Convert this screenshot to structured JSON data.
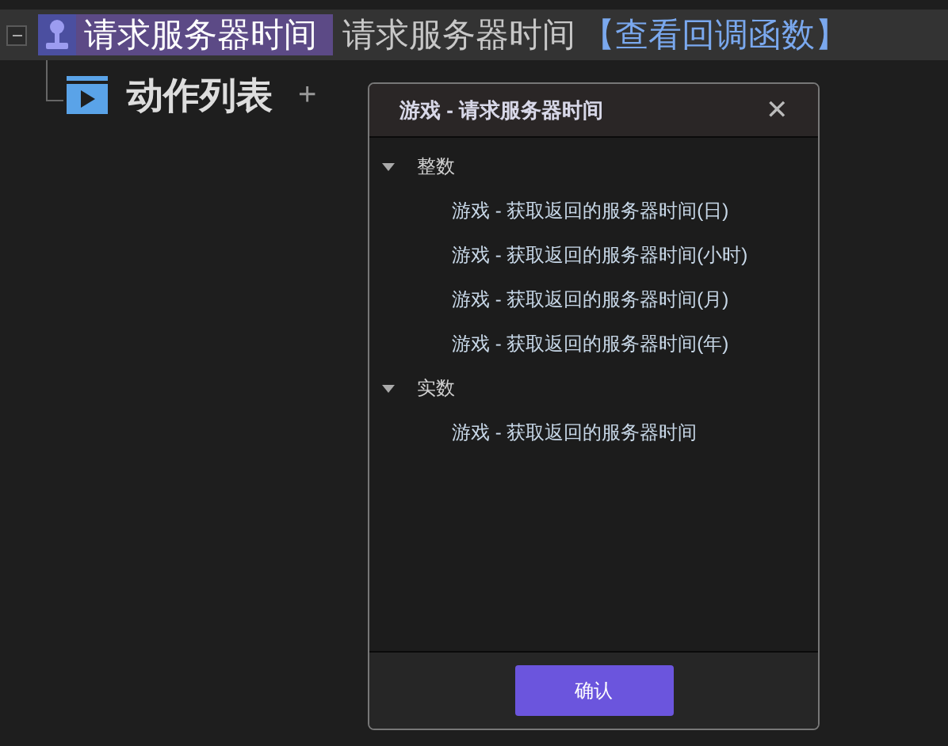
{
  "event_row": {
    "title": "请求服务器时间",
    "description": "请求服务器时间",
    "link": "【查看回调函数】",
    "expanded": true
  },
  "action_list": {
    "label": "动作列表",
    "add": "+"
  },
  "dialog": {
    "title": "游戏 - 请求服务器时间",
    "close": "✕",
    "groups": [
      {
        "label": "整数",
        "expanded": true,
        "items": [
          "游戏 - 获取返回的服务器时间(日)",
          "游戏 - 获取返回的服务器时间(小时)",
          "游戏 - 获取返回的服务器时间(月)",
          "游戏 - 获取返回的服务器时间(年)"
        ]
      },
      {
        "label": "实数",
        "expanded": true,
        "items": [
          "游戏 - 获取返回的服务器时间"
        ]
      }
    ],
    "confirm": "确认"
  }
}
